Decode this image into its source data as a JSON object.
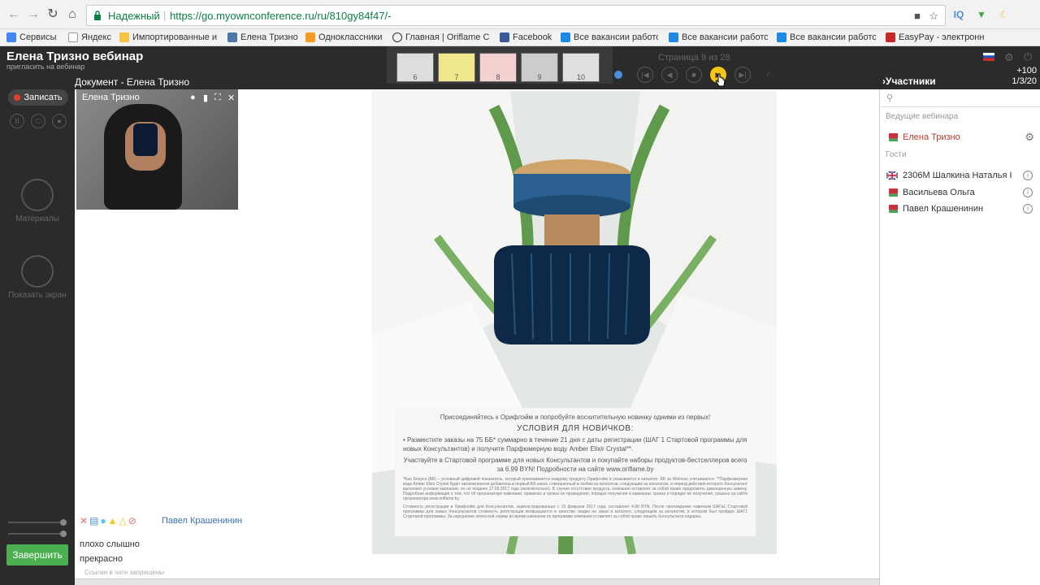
{
  "browser": {
    "secure_label": "Надежный",
    "url": "https://go.myownconference.ru/ru/810gy84f47/-",
    "bookmarks": [
      {
        "label": "Сервисы",
        "color": "#4285f4"
      },
      {
        "label": "Яндекс",
        "color": "#e53935"
      },
      {
        "label": "Импортированные и",
        "color": "#f6c343"
      },
      {
        "label": "Елена Тризно",
        "color": "#4a76a8"
      },
      {
        "label": "Одноклассники",
        "color": "#f59a23"
      },
      {
        "label": "Главная | Oriflame Co",
        "color": "#333333"
      },
      {
        "label": "Facebook",
        "color": "#3b5998"
      },
      {
        "label": "Все вакансии работо",
        "color": "#1e88e5"
      },
      {
        "label": "Все вакансии работо",
        "color": "#1e88e5"
      },
      {
        "label": "Все вакансии работо",
        "color": "#1e88e5"
      },
      {
        "label": "EasyPay - электронн",
        "color": "#c62828"
      }
    ]
  },
  "header": {
    "title": "Елена Тризно вебинар",
    "invite": "пригласить на вебинар",
    "document_title": "Документ - Елена Тризно",
    "page_counter": "Страница 9 из 28",
    "thumbnails": [
      "6",
      "7",
      "8",
      "9",
      "10"
    ],
    "participants_label": "Участники",
    "count_top": "+100",
    "count_bottom": "1/3/20"
  },
  "left_panel": {
    "record_label": "Записать",
    "materials_label": "Материалы",
    "share_screen_label": "Показать экран",
    "finish_label": "Завершить"
  },
  "webcam": {
    "name": "Елена Тризно"
  },
  "slide": {
    "caption_line1": "Присоединяйтесь к Орифлэйм и попробуйте восхитительную новинку одними из первых!",
    "conditions_heading": "УСЛОВИЯ ДЛЯ НОВИЧКОВ:",
    "condition1": "• Разместите заказы на 75 ББ* суммарно в течение 21 дня с даты регистрации (ШАГ 1 Стартовой программы для новых Консультантов) и получите Парфюмерную воду Amber Elixir Crystal**.",
    "condition2": "Участвуйте в Стартовой программе для новых Консультантов и покупайте наборы продуктов-бестселлеров всего за 6.99 BYN! Подробности на сайте www.oriflame.by",
    "fine_print1": "*Бал Бонуса (ББ) – условный цифровой показатель, который присваивается каждому продукту Орифлэйм и указывается в каталоге. ББ за Welness учитываются. **Парфюмерная вода Amber Elixir Crystal будет автоматически добавлена в первый ББ-заказ, совершенный в любом из каталогов, следующим за каталогом, в период действия которого Консультант выполнил условия кампании, но не позднее 27.09.2017 года (включительно). В случае отсутствия продукта, компания оставляет за собой право предложить равноценную замену. Подробная информация о том, что об организаторе кампании, правилах и сроках ее проведения, порядке получения в кампании, сроках и порядке ее получения, указана на сайте организатора www.oriflame.by",
    "fine_print2": "Стоимость регистрации в Орифлэйм для Консультантов, зарегистрированных с 15 февраля 2017 года, составляет 4.99 BYN. После прохождения новичком ШАГа1 Стартовой программы для новых Консультантов стоимость регистрации возвращается в качестве скидки на заказ в каталоге, следующем за каталогом, в котором был пройден ШАГ1 Стартовой программы. За нарушение этической нормы во время кампании по программе компания оставляет за собой право лишить Консультанта подарка."
  },
  "chat": {
    "author": "Павел Крашенинин",
    "messages": [
      "плохо слышно",
      "прекрасно"
    ],
    "disabled_note": "Ссылки в чате запрещены"
  },
  "participants": {
    "hosts_label": "Ведущие вебинара",
    "guests_label": "Гости",
    "host": {
      "name": "Елена Тризно"
    },
    "guests": [
      {
        "name": "2306М Шалкина Наталья І"
      },
      {
        "name": "Васильева Ольга"
      },
      {
        "name": "Павел Крашенинин"
      }
    ]
  },
  "colors": {
    "header_bg": "#2b2b2b",
    "finish_green": "#4caf50",
    "record_red": "#e53935",
    "host_red": "#c0392b",
    "secure_green": "#0b8043"
  }
}
